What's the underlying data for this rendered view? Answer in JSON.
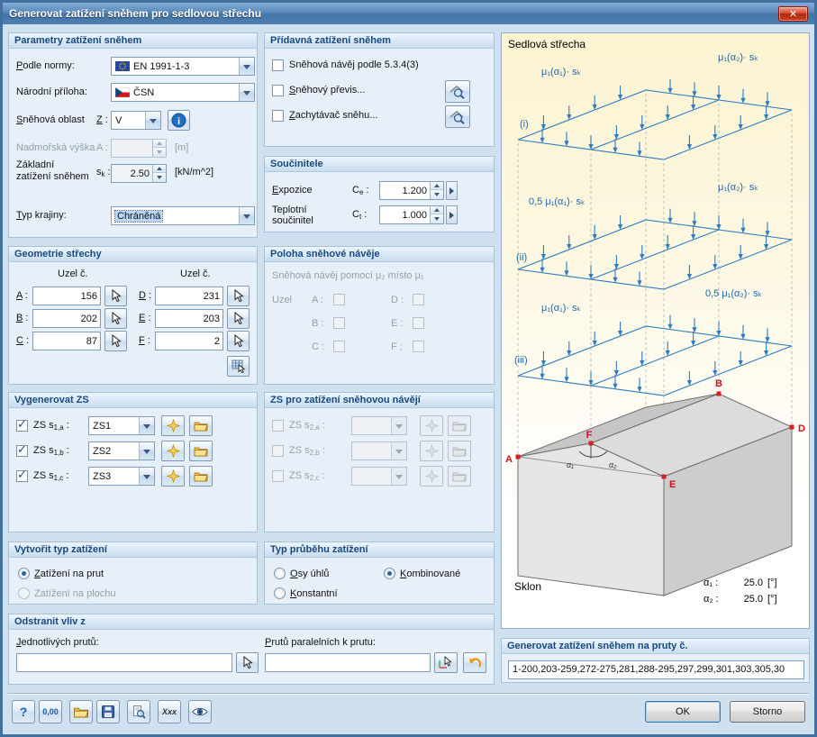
{
  "window": {
    "title": "Generovat zatížení sněhem pro sedlovou střechu"
  },
  "icons": {
    "check": "✓",
    "info": "i",
    "close": "✕"
  },
  "params": {
    "title": "Parametry zatížení sněhem",
    "norm_label": "Podle normy:",
    "norm_value": "EN 1991-1-3",
    "annex_label": "Národní příloha:",
    "annex_value": "ČSN",
    "zone_label": "Sněhová oblast",
    "zone_sym": "Z :",
    "zone_value": "V",
    "alt_label": "Nadmořská výška",
    "alt_sym": "A :",
    "alt_unit": "[m]",
    "sk_label1": "Základní",
    "sk_label2": "zatížení sněhem",
    "sk_pre": "s",
    "sk_sub": "k",
    "sk_post": " :",
    "sk_value": "2.50",
    "sk_unit": "[kN/m^2]",
    "terrain_label": "Typ krajiny:",
    "terrain_value": "Chráněná"
  },
  "geometry": {
    "title": "Geometrie střechy",
    "col_header": "Uzel č.",
    "nodes": [
      {
        "label": "A :",
        "value": "156"
      },
      {
        "label": "B :",
        "value": "202"
      },
      {
        "label": "C :",
        "value": "87"
      },
      {
        "label": "D :",
        "value": "231"
      },
      {
        "label": "E :",
        "value": "203"
      },
      {
        "label": "F :",
        "value": "2"
      }
    ]
  },
  "generate_lc": {
    "title": "Vygenerovat ZS",
    "rows": [
      {
        "pre": "ZS s",
        "sub": "1,a",
        "post": " :",
        "value": "ZS1",
        "checked": true
      },
      {
        "pre": "ZS s",
        "sub": "1,b",
        "post": " :",
        "value": "ZS2",
        "checked": true
      },
      {
        "pre": "ZS s",
        "sub": "1,c",
        "post": " :",
        "value": "ZS3",
        "checked": true
      }
    ]
  },
  "load_type": {
    "title": "Vytvořit typ zatížení",
    "option1": "Zatížení na prut",
    "option2": "Zatížení na plochu"
  },
  "remove": {
    "title": "Odstranit vliv z",
    "single_label": "Jednotlivých prutů:",
    "single_value": "",
    "parallel_label": "Prutů paralelních k prutu:",
    "parallel_value": ""
  },
  "additional": {
    "title": "Přídavná zatížení sněhem",
    "item1": "Sněhová návěj podle 5.3.4(3)",
    "item2": "Sněhový převis...",
    "item3": "Zachytávač sněhu..."
  },
  "coefficients": {
    "title": "Součinitele",
    "exp_label": "Expozice",
    "exp_pre": "C",
    "exp_sub": "e",
    "exp_post": " :",
    "exp_value": "1.200",
    "th_label1": "Teplotní",
    "th_label2": "součinitel",
    "th_pre": "C",
    "th_sub": "t",
    "th_post": " :",
    "th_value": "1.000"
  },
  "drift_position": {
    "title": "Poloha sněhové návěje",
    "note": "Sněhová návěj pomocí μ₂ místo μ₁",
    "uzel": "Uzel",
    "a": "A :",
    "b": "B :",
    "c": "C :",
    "d": "D :",
    "e": "E :",
    "f": "F :"
  },
  "drift_lc": {
    "title": "ZS pro zatížení sněhovou návějí",
    "rows": [
      {
        "pre": "ZS s",
        "sub": "2,a",
        "post": " :"
      },
      {
        "pre": "ZS s",
        "sub": "2,b",
        "post": " :"
      },
      {
        "pre": "ZS s",
        "sub": "2,c",
        "post": " :"
      }
    ]
  },
  "distribution": {
    "title": "Typ průběhu zatížení",
    "option1": "Osy úhlů",
    "option2": "Kombinované",
    "option3": "Konstantní"
  },
  "preview": {
    "title": "Sedlová střecha",
    "levels": [
      {
        "tag": "(i)",
        "left_label": "μ₁(α₁)· sₖ",
        "right_label": "μ₁(α₂)· sₖ"
      },
      {
        "tag": "(ii)",
        "left_label": "0,5 μ₁(α₁)· sₖ",
        "right_label": "μ₁(α₂)· sₖ"
      },
      {
        "tag": "(iii)",
        "left_label": "μ₁(α₁)· sₖ",
        "right_label": "0,5 μ₁(α₂)· sₖ"
      }
    ],
    "nodes": {
      "a": "A",
      "b": "B",
      "d": "D",
      "e": "E",
      "f": "F"
    },
    "angle1": "α₁",
    "angle2": "α₂",
    "slope_label": "Sklon",
    "alpha1_sym": "α₁ :",
    "alpha1_value": "25.0",
    "alpha2_sym": "α₂ :",
    "alpha2_value": "25.0",
    "unit": "[°]"
  },
  "members": {
    "title": "Generovat zatížení sněhem na pruty č.",
    "value": "1-200,203-259,272-275,281,288-295,297,299,301,303,305,30"
  },
  "footer": {
    "ok": "OK",
    "cancel": "Storno",
    "help": "?",
    "units": "0,00",
    "comment": "Xxx"
  },
  "colors": {
    "accent_blue": "#2f7bbf",
    "node_red": "#d42020",
    "header_text": "#17497e"
  }
}
